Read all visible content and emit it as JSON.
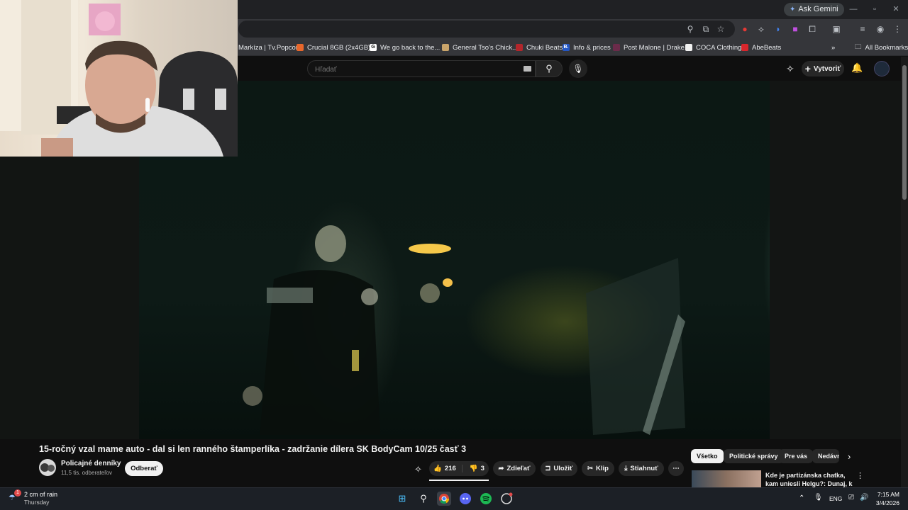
{
  "browser": {
    "ask_gemini": "Ask Gemini",
    "bookmarks": [
      "Markíza | Tv.Popcor...",
      "Crucial 8GB (2x4GB)...",
      "We go back to the...",
      "General Tso's Chick...",
      "Chuki Beats",
      "Info & prices",
      "Post Malone | Drake...",
      "COCA Clothing",
      "AbeBeats"
    ],
    "all_bookmarks": "All Bookmarks"
  },
  "youtube": {
    "search_placeholder": "Hľadať",
    "create_label": "Vytvoriť",
    "video_title": "15-ročný vzal mame auto - dal si len ranného štamperlíka - zadržanie dílera SK BodyCam 10/25 časť 3",
    "channel_name": "Policajné denníky",
    "subscriber_count": "11,5 tis. odberateľov",
    "subscribe_label": "Odberať",
    "like_count": "216",
    "dislike_count": "3",
    "share_label": "Zdieľať",
    "save_label": "Uložiť",
    "clip_label": "Klip",
    "download_label": "Stiahnuť",
    "chips": [
      "Všetko",
      "Politické správy",
      "Pre vás",
      "Nedávno"
    ],
    "recommendation_title": "Kde je partizánska chatka, kam unieslі Helgu?: Dunaj, k vašim ..."
  },
  "taskbar": {
    "weather_text": "2 cm of rain",
    "weather_day": "Thursday",
    "weather_badge": "1",
    "language": "ENG",
    "time": "7:15 AM",
    "date": "3/4/2026"
  },
  "colors": {
    "youtube_bg": "#0f0f0f",
    "chrome_bar": "#35363a",
    "taskbar": "#1c2026"
  }
}
